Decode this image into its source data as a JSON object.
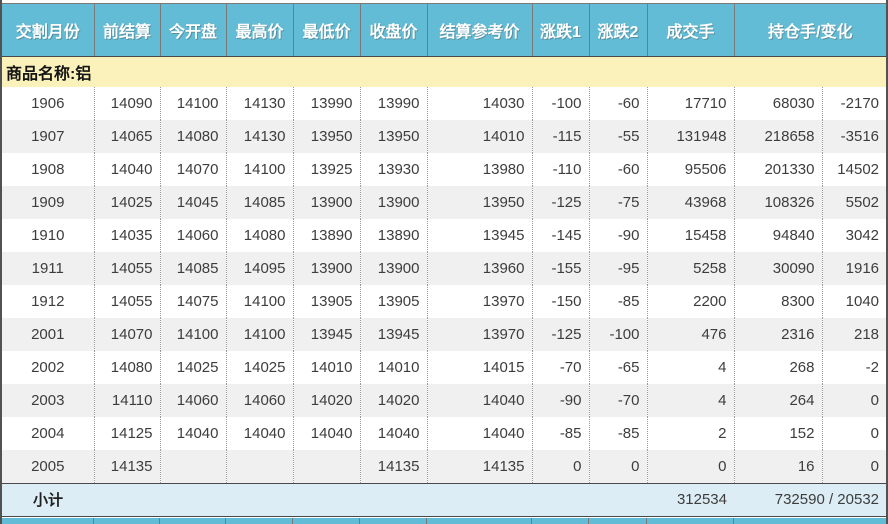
{
  "colors": {
    "header_bg": "#63bcd5",
    "header_text": "#ffffff",
    "commodity_row_bg": "#fbf2bb",
    "subtotal_row_bg": "#dcedf5",
    "row_alt_bg": "#f0f0f0",
    "text": "#3d3d3d"
  },
  "columns": [
    {
      "label": "交割月份"
    },
    {
      "label": "前结算"
    },
    {
      "label": "今开盘"
    },
    {
      "label": "最高价"
    },
    {
      "label": "最低价"
    },
    {
      "label": "收盘价"
    },
    {
      "label": "结算参考价"
    },
    {
      "label": "涨跌1"
    },
    {
      "label": "涨跌2"
    },
    {
      "label": "成交手"
    },
    {
      "label": "持仓手/变化"
    }
  ],
  "commodity": {
    "label": "商品名称:铝"
  },
  "rows": [
    {
      "month": "1906",
      "prev_settle": "14090",
      "open": "14100",
      "high": "14130",
      "low": "13990",
      "close": "13990",
      "settle_ref": "14030",
      "change1": "-100",
      "change2": "-60",
      "volume": "17710",
      "open_interest": "68030",
      "oi_change": "-2170"
    },
    {
      "month": "1907",
      "prev_settle": "14065",
      "open": "14080",
      "high": "14130",
      "low": "13950",
      "close": "13950",
      "settle_ref": "14010",
      "change1": "-115",
      "change2": "-55",
      "volume": "131948",
      "open_interest": "218658",
      "oi_change": "-3516"
    },
    {
      "month": "1908",
      "prev_settle": "14040",
      "open": "14070",
      "high": "14100",
      "low": "13925",
      "close": "13930",
      "settle_ref": "13980",
      "change1": "-110",
      "change2": "-60",
      "volume": "95506",
      "open_interest": "201330",
      "oi_change": "14502"
    },
    {
      "month": "1909",
      "prev_settle": "14025",
      "open": "14045",
      "high": "14085",
      "low": "13900",
      "close": "13900",
      "settle_ref": "13950",
      "change1": "-125",
      "change2": "-75",
      "volume": "43968",
      "open_interest": "108326",
      "oi_change": "5502"
    },
    {
      "month": "1910",
      "prev_settle": "14035",
      "open": "14060",
      "high": "14080",
      "low": "13890",
      "close": "13890",
      "settle_ref": "13945",
      "change1": "-145",
      "change2": "-90",
      "volume": "15458",
      "open_interest": "94840",
      "oi_change": "3042"
    },
    {
      "month": "1911",
      "prev_settle": "14055",
      "open": "14085",
      "high": "14095",
      "low": "13900",
      "close": "13900",
      "settle_ref": "13960",
      "change1": "-155",
      "change2": "-95",
      "volume": "5258",
      "open_interest": "30090",
      "oi_change": "1916"
    },
    {
      "month": "1912",
      "prev_settle": "14055",
      "open": "14075",
      "high": "14100",
      "low": "13905",
      "close": "13905",
      "settle_ref": "13970",
      "change1": "-150",
      "change2": "-85",
      "volume": "2200",
      "open_interest": "8300",
      "oi_change": "1040"
    },
    {
      "month": "2001",
      "prev_settle": "14070",
      "open": "14100",
      "high": "14100",
      "low": "13945",
      "close": "13945",
      "settle_ref": "13970",
      "change1": "-125",
      "change2": "-100",
      "volume": "476",
      "open_interest": "2316",
      "oi_change": "218"
    },
    {
      "month": "2002",
      "prev_settle": "14080",
      "open": "14025",
      "high": "14025",
      "low": "14010",
      "close": "14010",
      "settle_ref": "14015",
      "change1": "-70",
      "change2": "-65",
      "volume": "4",
      "open_interest": "268",
      "oi_change": "-2"
    },
    {
      "month": "2003",
      "prev_settle": "14110",
      "open": "14060",
      "high": "14060",
      "low": "14020",
      "close": "14020",
      "settle_ref": "14040",
      "change1": "-90",
      "change2": "-70",
      "volume": "4",
      "open_interest": "264",
      "oi_change": "0"
    },
    {
      "month": "2004",
      "prev_settle": "14125",
      "open": "14040",
      "high": "14040",
      "low": "14040",
      "close": "14040",
      "settle_ref": "14040",
      "change1": "-85",
      "change2": "-85",
      "volume": "2",
      "open_interest": "152",
      "oi_change": "0"
    },
    {
      "month": "2005",
      "prev_settle": "14135",
      "open": "",
      "high": "",
      "low": "",
      "close": "14135",
      "settle_ref": "14135",
      "change1": "0",
      "change2": "0",
      "volume": "0",
      "open_interest": "16",
      "oi_change": "0"
    }
  ],
  "subtotal": {
    "label": "小计",
    "volume": "312534",
    "oi_change_combined": "732590 / 20532"
  }
}
